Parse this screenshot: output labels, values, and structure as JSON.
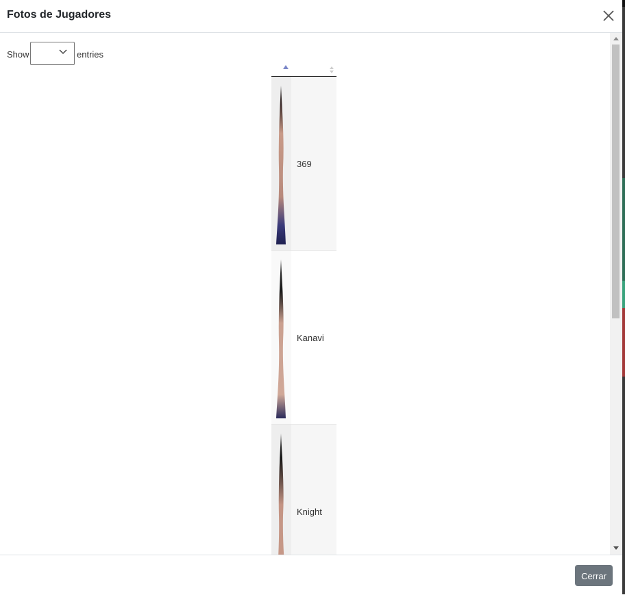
{
  "modal": {
    "title": "Fotos de Jugadores",
    "close_icon": "close-icon"
  },
  "length_control": {
    "show_label": "Show",
    "entries_label": "entries",
    "selected_value": ""
  },
  "table": {
    "columns": [
      {
        "label": "",
        "sort": "ascending"
      },
      {
        "label": "",
        "sort": "none"
      }
    ],
    "rows": [
      {
        "photo": "player-photo",
        "name": "369"
      },
      {
        "photo": "player-photo",
        "name": "Kanavi"
      },
      {
        "photo": "player-photo",
        "name": "Knight"
      }
    ]
  },
  "footer": {
    "close_label": "Cerrar"
  },
  "colors": {
    "close_button": "#6c757d",
    "sort_active": "#7a86c8"
  }
}
